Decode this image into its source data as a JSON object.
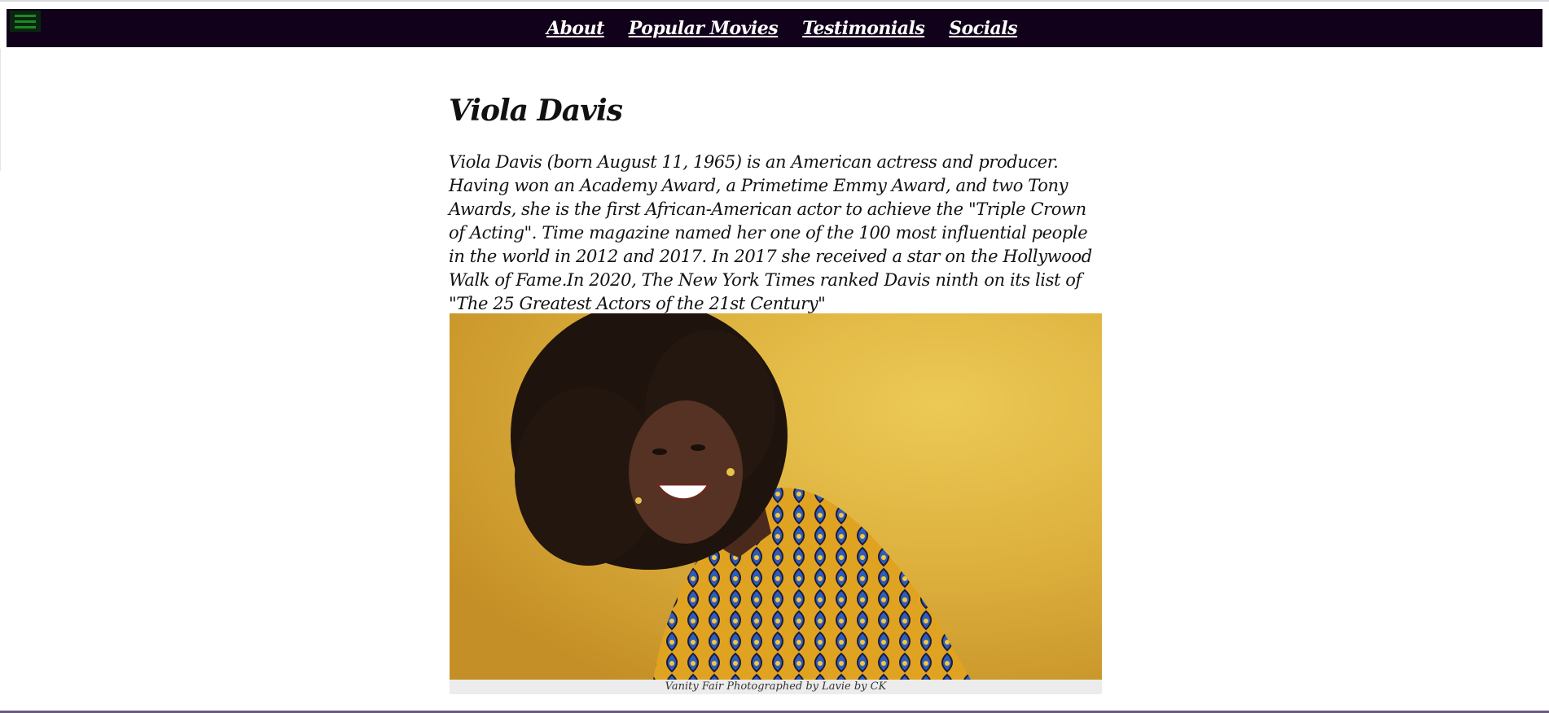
{
  "nav": {
    "menu_icon": "hamburger-menu-icon",
    "links": [
      {
        "label": "About"
      },
      {
        "label": "Popular Movies"
      },
      {
        "label": "Testimonials"
      },
      {
        "label": "Socials"
      }
    ]
  },
  "main": {
    "title": "Viola Davis",
    "bio": "Viola Davis (born August 11, 1965) is an American actress and producer. Having won an Academy Award, a Primetime Emmy Award, and two Tony Awards, she is the first African-American actor to achieve the \"Triple Crown of Acting\". Time magazine named her one of the 100 most influential people in the world in 2012 and 2017. In 2017 she received a star on the Hollywood Walk of Fame.In 2020, The New York Times ranked Davis ninth on its list of \"The 25 Greatest Actors of the 21st Century\"",
    "figure": {
      "caption": "Vanity Fair Photographed by Lavie by CK"
    }
  },
  "colors": {
    "navbar_bg": "#12011a",
    "menu_icon": "#1c8a22",
    "photo_bg": "#ddb03d"
  }
}
